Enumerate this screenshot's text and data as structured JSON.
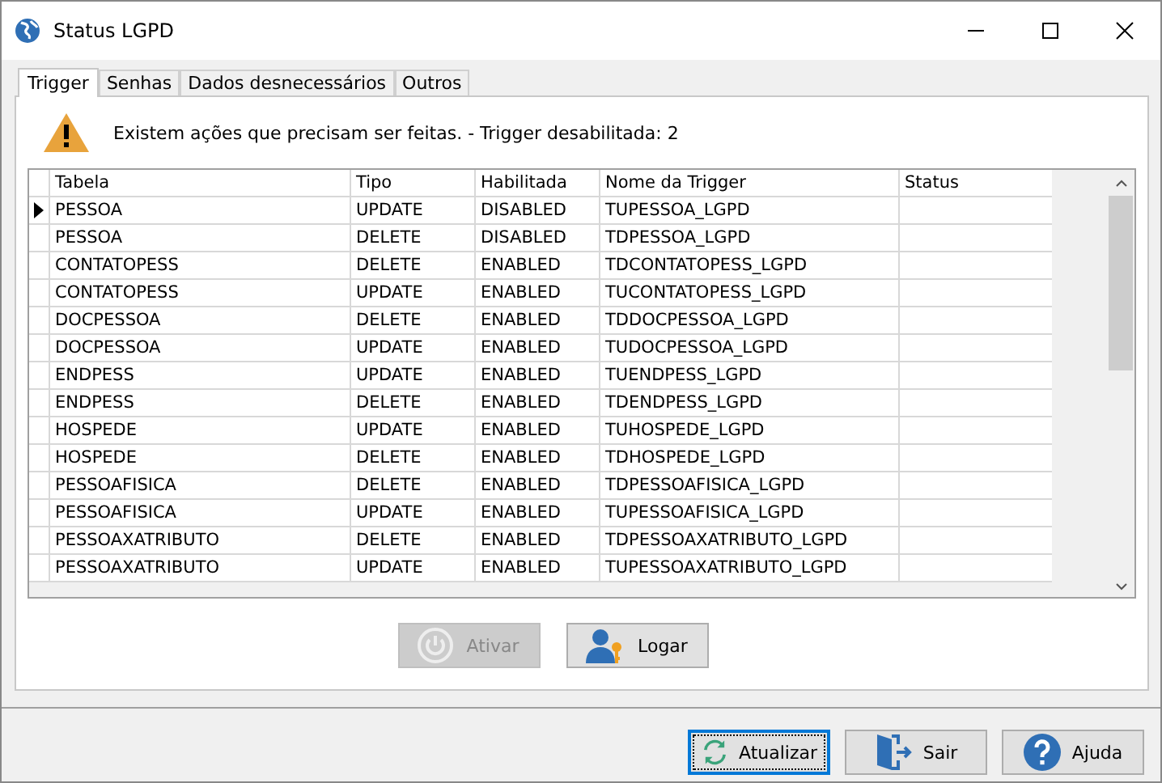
{
  "window": {
    "title": "Status LGPD"
  },
  "tabs": [
    {
      "label": "Trigger",
      "selected": true
    },
    {
      "label": "Senhas",
      "selected": false
    },
    {
      "label": "Dados desnecessários",
      "selected": false
    },
    {
      "label": "Outros",
      "selected": false
    }
  ],
  "warning": "Existem ações que precisam ser feitas. - Trigger desabilitada: 2",
  "table": {
    "columns": [
      "Tabela",
      "Tipo",
      "Habilitada",
      "Nome da Trigger",
      "Status"
    ],
    "rows": [
      {
        "selected": true,
        "cells": [
          "PESSOA",
          "UPDATE",
          "DISABLED",
          "TUPESSOA_LGPD"
        ]
      },
      {
        "selected": false,
        "cells": [
          "PESSOA",
          "DELETE",
          "DISABLED",
          "TDPESSOA_LGPD"
        ]
      },
      {
        "selected": false,
        "cells": [
          "CONTATOPESS",
          "DELETE",
          "ENABLED",
          "TDCONTATOPESS_LGPD"
        ]
      },
      {
        "selected": false,
        "cells": [
          "CONTATOPESS",
          "UPDATE",
          "ENABLED",
          "TUCONTATOPESS_LGPD"
        ]
      },
      {
        "selected": false,
        "cells": [
          "DOCPESSOA",
          "DELETE",
          "ENABLED",
          "TDDOCPESSOA_LGPD"
        ]
      },
      {
        "selected": false,
        "cells": [
          "DOCPESSOA",
          "UPDATE",
          "ENABLED",
          "TUDOCPESSOA_LGPD"
        ]
      },
      {
        "selected": false,
        "cells": [
          "ENDPESS",
          "UPDATE",
          "ENABLED",
          "TUENDPESS_LGPD"
        ]
      },
      {
        "selected": false,
        "cells": [
          "ENDPESS",
          "DELETE",
          "ENABLED",
          "TDENDPESS_LGPD"
        ]
      },
      {
        "selected": false,
        "cells": [
          "HOSPEDE",
          "UPDATE",
          "ENABLED",
          "TUHOSPEDE_LGPD"
        ]
      },
      {
        "selected": false,
        "cells": [
          "HOSPEDE",
          "DELETE",
          "ENABLED",
          "TDHOSPEDE_LGPD"
        ]
      },
      {
        "selected": false,
        "cells": [
          "PESSOAFISICA",
          "DELETE",
          "ENABLED",
          "TDPESSOAFISICA_LGPD"
        ]
      },
      {
        "selected": false,
        "cells": [
          "PESSOAFISICA",
          "UPDATE",
          "ENABLED",
          "TUPESSOAFISICA_LGPD"
        ]
      },
      {
        "selected": false,
        "cells": [
          "PESSOAXATRIBUTO",
          "DELETE",
          "ENABLED",
          "TDPESSOAXATRIBUTO_LGPD"
        ]
      },
      {
        "selected": false,
        "cells": [
          "PESSOAXATRIBUTO",
          "UPDATE",
          "ENABLED",
          "TUPESSOAXATRIBUTO_LGPD"
        ]
      }
    ]
  },
  "actions": [
    {
      "label": "Ativar",
      "kind": "power",
      "disabled": true
    },
    {
      "label": "Logar",
      "kind": "user",
      "disabled": false
    }
  ],
  "footer_buttons": [
    {
      "label": "Atualizar",
      "kind": "refresh",
      "focused": true
    },
    {
      "label": "Sair",
      "kind": "exit",
      "focused": false
    },
    {
      "label": "Ajuda",
      "kind": "help",
      "focused": false
    }
  ]
}
